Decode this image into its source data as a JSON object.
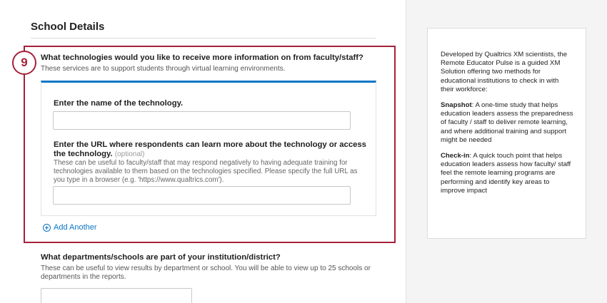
{
  "section": {
    "title": "School Details"
  },
  "step": {
    "number": "9"
  },
  "question": {
    "title": "What technologies would you like to receive more information on from faculty/staff?",
    "subtitle": "These services are to support students through virtual learning environments."
  },
  "tech_name": {
    "label": "Enter the name of the technology.",
    "value": "",
    "placeholder": ""
  },
  "tech_url": {
    "label": "Enter the URL where respondents can learn more about the technology or access the technology.",
    "optional": "(optional)",
    "help": "These can be useful to faculty/staff that may respond negatively to having adequate training for technologies available to them based on the technologies specified. Please specify the full URL as you type in a browser (e.g. 'https://www.qualtrics.com').",
    "value": "",
    "placeholder": ""
  },
  "add_another": {
    "label": "Add Another"
  },
  "departments": {
    "title": "What departments/schools are part of your institution/district?",
    "subtitle": "These can be useful to view results by department or school. You will be able to view up to 25 schools or departments in the reports."
  },
  "info": {
    "intro": "Developed by Qualtrics XM scientists, the Remote Educator Pulse is a guided XM Solution offering two methods for educational institutions to check in with their workforce:",
    "snapshot_title": "Snapshot",
    "snapshot_text": ": A one-time study that helps education leaders assess the preparedness of faculty / staff to deliver remote learning, and where additional training and support might be needed",
    "checkin_title": "Check-in",
    "checkin_text": ": A quick touch point that helps education leaders assess how faculty/ staff feel the remote learning programs are performing and identify key areas to improve impact"
  },
  "colors": {
    "highlight": "#a4213a",
    "accent": "#0b76c5",
    "sidebar_bg": "#f4f4f4"
  }
}
